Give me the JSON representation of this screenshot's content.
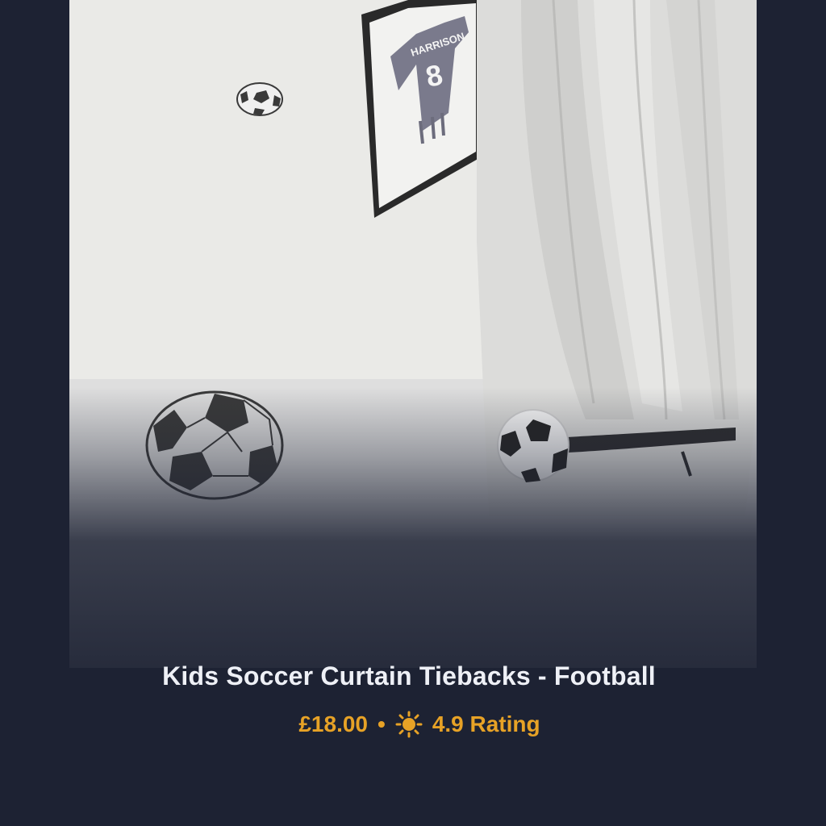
{
  "product": {
    "title": "Kids Soccer Curtain Tiebacks - Football",
    "price": "£18.00",
    "separator": "•",
    "rating": "4.9 Rating",
    "icons": {
      "rating": "sun-icon"
    }
  },
  "photo": {
    "jersey_name": "HARRISON",
    "jersey_number": "8"
  },
  "colors": {
    "background": "#1d2233",
    "title": "#eef0f6",
    "accent": "#e7a226"
  }
}
